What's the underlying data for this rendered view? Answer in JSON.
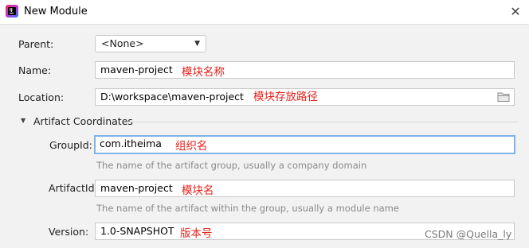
{
  "window": {
    "title": "New Module"
  },
  "form": {
    "parent_label": "Parent:",
    "parent_value": "<None>",
    "name_label": "Name:",
    "name_value": "maven-project",
    "name_note": "模块名称",
    "location_label": "Location:",
    "location_value": "D:\\workspace\\maven-project",
    "location_note": "模块存放路径",
    "section_title": "Artifact Coordinates",
    "groupid_label": "GroupId:",
    "groupid_value": "com.itheima",
    "groupid_note": "组织名",
    "groupid_hint": "The name of the artifact group, usually a company domain",
    "artifactid_label": "ArtifactId:",
    "artifactid_value": "maven-project",
    "artifactid_note": "模块名",
    "artifactid_hint": "The name of the artifact within the group, usually a module name",
    "version_label": "Version:",
    "version_value": "1.0-SNAPSHOT",
    "version_note": "版本号"
  },
  "watermark": "CSDN @Quella_ly",
  "icons": {
    "app": "intellij-idea-icon",
    "close": "close-icon",
    "dropdown": "chevron-down-icon",
    "folder": "folder-icon",
    "section": "triangle-down-icon"
  },
  "colors": {
    "annotation": "#e6231e",
    "focus_border": "#7fb2e8",
    "hint": "#8a8a8a"
  }
}
